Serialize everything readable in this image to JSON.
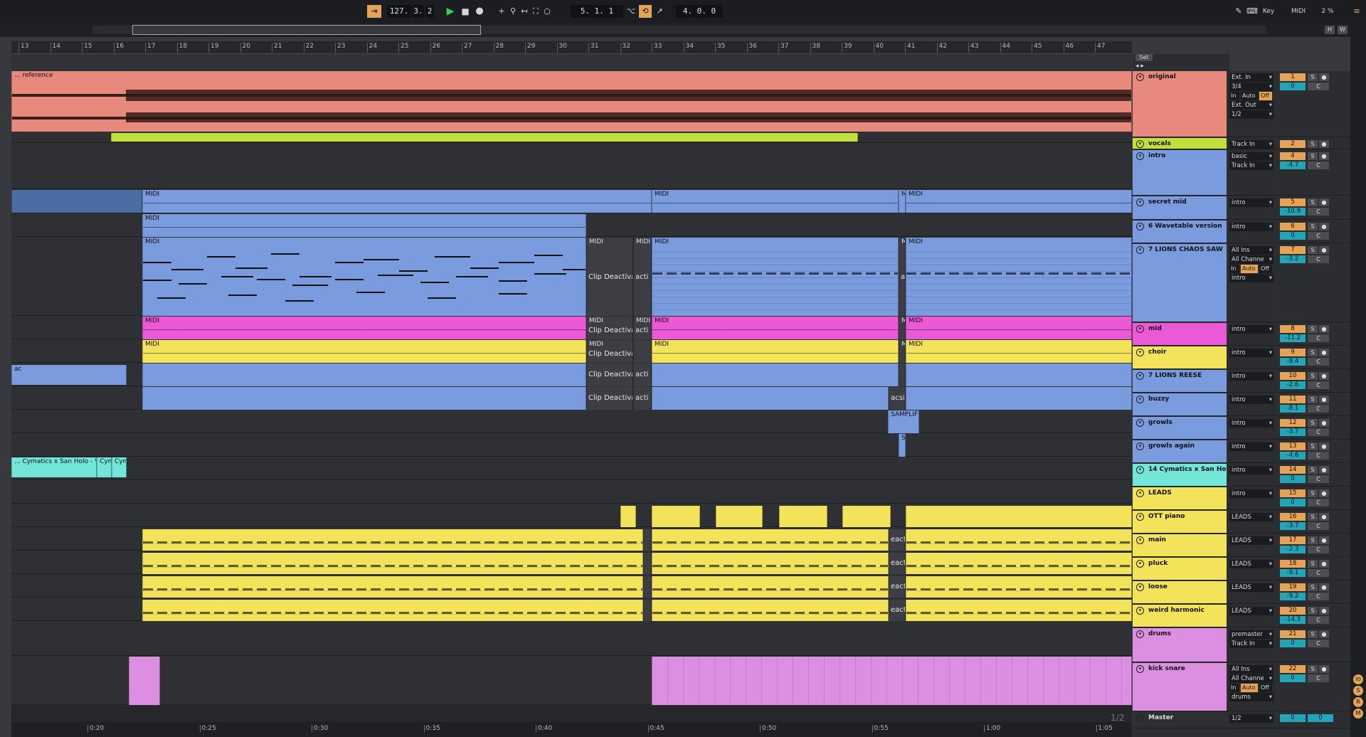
{
  "transport": {
    "tempo": "127.",
    "sig_a": "3.",
    "sig_b": "2",
    "position": "5.  1.  1",
    "loop_len": "4.  0.  0",
    "key": "Key",
    "midi": "MIDI",
    "cpu": "2 %"
  },
  "overview": {
    "h": "H",
    "w": "W"
  },
  "ruler": {
    "bars": [
      "13",
      "14",
      "15",
      "16",
      "17",
      "18",
      "19",
      "20",
      "21",
      "22",
      "23",
      "24",
      "25",
      "26",
      "27",
      "28",
      "29",
      "30",
      "31",
      "32",
      "33",
      "34",
      "35",
      "36",
      "37",
      "38",
      "39",
      "40",
      "41",
      "42",
      "43",
      "44",
      "45",
      "46",
      "47"
    ]
  },
  "timebar": {
    "labels": [
      "0:20",
      "0:25",
      "0:30",
      "0:35",
      "0:40",
      "0:45",
      "0:50",
      "0:55",
      "1:00",
      "1:05"
    ],
    "page": "1/2"
  },
  "set_label": "Set",
  "clips": {
    "reference": "... reference",
    "midi": "MIDI",
    "m": "M",
    "clip_deactivated": "Clip Deactivated",
    "eacti": "eacti",
    "acti": "acti",
    "acsi": "acsi",
    "ac": "ac",
    "sampler": "SAMPLIF",
    "sa": "SA",
    "cymatics": "... Cymatics x San Holo - Vi",
    "cym": "Cym"
  },
  "tracks": [
    {
      "name": "original",
      "io": [
        "Ext. In",
        "3/4"
      ],
      "mon": true,
      "io2": [
        "Ext. Out",
        "1/2"
      ],
      "num": "1",
      "vol": "0",
      "c": "C",
      "color": "#e8897d"
    },
    {
      "name": "vocals",
      "io": [
        "Track In"
      ],
      "num": "2",
      "color": "#c1e03b"
    },
    {
      "name": "intro",
      "io": [
        "basic",
        "Track In"
      ],
      "num": "4",
      "vol": "-4.7",
      "c": "C",
      "color": "#7a9bde"
    },
    {
      "name": "secret mid",
      "io": [
        "intro"
      ],
      "num": "5",
      "vol": "-10.9",
      "c": "C",
      "color": "#7a9bde"
    },
    {
      "name": "6 Wavetable version",
      "io": [
        "intro"
      ],
      "num": "6",
      "vol": "0",
      "c": "C",
      "color": "#7a9bde"
    },
    {
      "name": "7 LIONS CHAOS SAW",
      "io": [
        "All Ins",
        "All Channe"
      ],
      "mon": true,
      "io3": "intro",
      "num": "7",
      "vol": "-3.2",
      "c": "C",
      "color": "#7a9bde"
    },
    {
      "name": "mid",
      "io": [
        "intro"
      ],
      "num": "8",
      "vol": "-11.2",
      "c": "C",
      "color": "#ea5ad6"
    },
    {
      "name": "choir",
      "io": [
        "intro"
      ],
      "num": "9",
      "vol": "-9.4",
      "c": "C",
      "color": "#f2e35a"
    },
    {
      "name": "7 LIONS REESE",
      "io": [
        "intro"
      ],
      "num": "10",
      "vol": "-2.6",
      "c": "C",
      "color": "#7a9bde"
    },
    {
      "name": "buzzy",
      "io": [
        "intro"
      ],
      "num": "11",
      "vol": "-8.1",
      "c": "C",
      "color": "#7a9bde"
    },
    {
      "name": "growls",
      "io": [
        "intro"
      ],
      "num": "12",
      "vol": "-3.7",
      "c": "C",
      "color": "#7a9bde"
    },
    {
      "name": "growls again",
      "io": [
        "intro"
      ],
      "num": "13",
      "vol": "-4.6",
      "c": "C",
      "color": "#7a9bde"
    },
    {
      "name": "14 Cymatics x San Holo",
      "io": [
        "intro"
      ],
      "num": "14",
      "vol": "0",
      "c": "C",
      "color": "#72e6d8"
    },
    {
      "name": "LEADS",
      "io": [
        "intro"
      ],
      "num": "15",
      "vol": "0",
      "c": "C",
      "color": "#f2e35a"
    },
    {
      "name": "OTT piano",
      "io": [
        "LEADS"
      ],
      "num": "16",
      "vol": "-3.7",
      "c": "C",
      "color": "#f2e35a"
    },
    {
      "name": "main",
      "io": [
        "LEADS"
      ],
      "num": "17",
      "vol": "-2.3",
      "c": "C",
      "color": "#f2e35a"
    },
    {
      "name": "pluck",
      "io": [
        "LEADS"
      ],
      "num": "18",
      "vol": "-9.1",
      "c": "C",
      "color": "#f2e35a"
    },
    {
      "name": "loose",
      "io": [
        "LEADS"
      ],
      "num": "19",
      "vol": "-9.2",
      "c": "C",
      "color": "#f2e35a"
    },
    {
      "name": "weird harmonic",
      "io": [
        "LEADS"
      ],
      "num": "20",
      "vol": "-14.3",
      "c": "C",
      "color": "#f2e35a"
    },
    {
      "name": "drums",
      "io": [
        "premaster",
        "Track In"
      ],
      "num": "21",
      "vol": "0",
      "c": "C",
      "color": "#dc8ee0"
    },
    {
      "name": "kick snare",
      "io": [
        "All Ins",
        "All Channe"
      ],
      "mon": true,
      "io3": "drums",
      "num": "22",
      "vol": "0",
      "c": "C",
      "color": "#dc8ee0"
    },
    {
      "name": "Master",
      "io": [
        "1/2"
      ],
      "num": "0",
      "vol": "0",
      "color": "#2d2f33"
    }
  ],
  "labels": {
    "in": "In",
    "auto": "Auto",
    "off": "Off",
    "s": "S"
  }
}
